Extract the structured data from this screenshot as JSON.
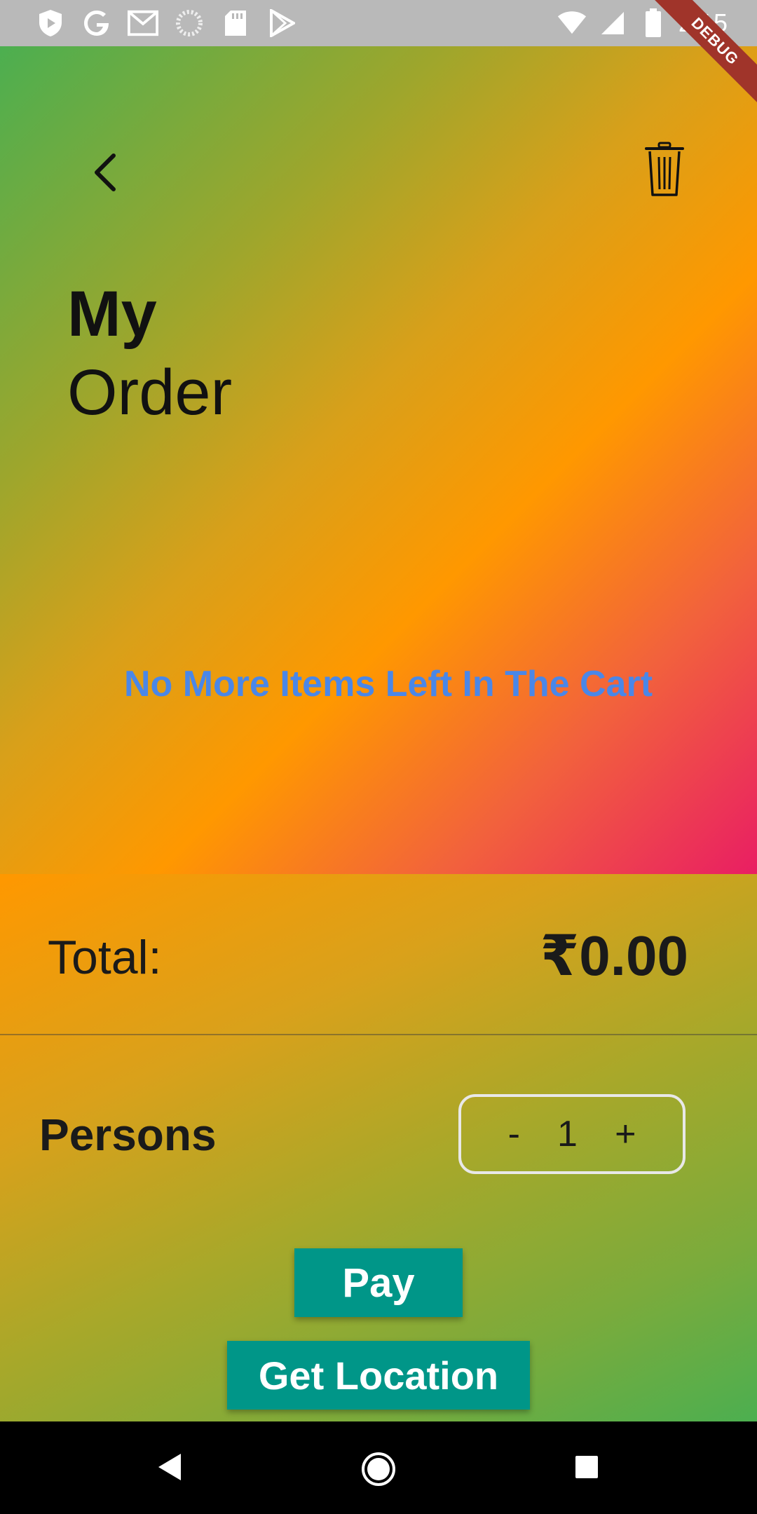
{
  "status_bar": {
    "time": "2:15",
    "icons_left": [
      "shield-icon",
      "google-icon",
      "gmail-icon",
      "loader-icon",
      "sdcard-icon",
      "play-store-icon"
    ],
    "icons_right": [
      "wifi-icon",
      "signal-icon",
      "battery-icon"
    ]
  },
  "debug_banner": "DEBUG",
  "header": {
    "title_line1": "My",
    "title_line2": "Order"
  },
  "cart": {
    "empty_message": "No More Items Left In The Cart"
  },
  "summary": {
    "total_label": "Total:",
    "total_value": "₹0.00",
    "persons_label": "Persons",
    "stepper": {
      "minus": "-",
      "value": "1",
      "plus": "+"
    }
  },
  "actions": {
    "pay_label": "Pay",
    "location_label": "Get Location"
  },
  "colors": {
    "accent_button": "#009688",
    "empty_message": "#4a87e8",
    "gradient_stops": [
      "#4caf50",
      "#ff9800",
      "#e91e63"
    ]
  }
}
